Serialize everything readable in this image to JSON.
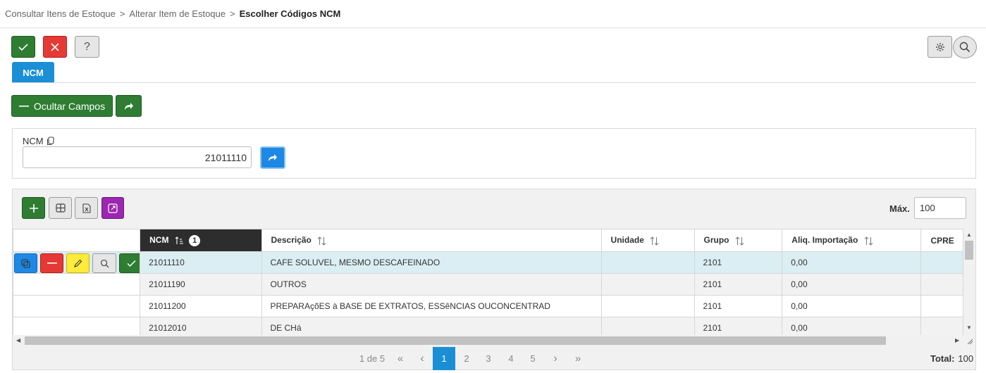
{
  "breadcrumb": {
    "items": [
      "Consultar Itens de Estoque",
      "Alterar Item de Estoque"
    ],
    "separator": ">",
    "current": "Escolher Códigos NCM"
  },
  "toolbar": {
    "confirm_icon": "check-icon",
    "cancel_icon": "close-icon",
    "help_label": "?",
    "settings_icon": "gear-icon",
    "search_icon": "search-icon"
  },
  "tab": {
    "label": "NCM"
  },
  "filter_actions": {
    "hide_fields_label": "Ocultar Campos",
    "forward_icon": "share-arrow-icon"
  },
  "filter": {
    "ncm_label": "NCM",
    "ncm_value": "21011110"
  },
  "grid": {
    "max_label": "Máx.",
    "max_value": "100",
    "columns": [
      {
        "label": "NCM",
        "sort_order": "1"
      },
      {
        "label": "Descrição"
      },
      {
        "label": "Unidade"
      },
      {
        "label": "Grupo"
      },
      {
        "label": "Aliq. Importação"
      },
      {
        "label": "CPRE"
      }
    ],
    "rows": [
      {
        "ncm": "21011110",
        "descricao": "CAFE SOLUVEL, MESMO DESCAFEINADO",
        "unidade": "",
        "grupo": "2101",
        "aliq": "0,00"
      },
      {
        "ncm": "21011190",
        "descricao": "OUTROS",
        "unidade": "",
        "grupo": "2101",
        "aliq": "0,00"
      },
      {
        "ncm": "21011200",
        "descricao": "PREPARAçõES à BASE DE EXTRATOS, ESSêNCIAS OUCONCENTRAD",
        "unidade": "",
        "grupo": "2101",
        "aliq": "0,00"
      },
      {
        "ncm": "21012010",
        "descricao": "DE CHá",
        "unidade": "",
        "grupo": "2101",
        "aliq": "0,00"
      }
    ],
    "pagination": {
      "info": "1 de 5",
      "first": "«",
      "prev": "‹",
      "pages": [
        "1",
        "2",
        "3",
        "4",
        "5"
      ],
      "active_page": "1",
      "next": "›",
      "last": "»"
    },
    "total_label": "Total:",
    "total_value": "100"
  },
  "colors": {
    "primary_blue": "#1a8fd6",
    "green": "#2e7d32",
    "red": "#e53935",
    "selected_row": "#dbeef3",
    "header_sorted": "#2d2d2d"
  }
}
